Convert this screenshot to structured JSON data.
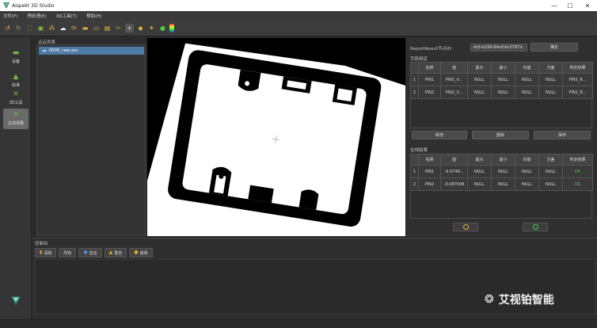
{
  "window": {
    "title": "Aispekt 3D Studio",
    "controls": [
      "—",
      "☐",
      "✕"
    ]
  },
  "menu": [
    "文件(F)",
    "预处理(E)",
    "3D工具(T)",
    "帮助(H)"
  ],
  "toolbar_icons": [
    "undo-icon",
    "redo-icon",
    "fit-view-icon",
    "select-box-icon",
    "points-icon",
    "cloud-icon",
    "rotate-icon",
    "folder-icon",
    "folder-open-icon",
    "save-icon",
    "crop-icon",
    "crosshair-icon",
    "cube-icon",
    "wand-icon",
    "sphere-icon",
    "color-map-icon"
  ],
  "sidebar": {
    "items": [
      {
        "label": "设备",
        "icon": "device-icon"
      },
      {
        "label": "标准",
        "icon": "standard-icon"
      },
      {
        "label": "3D工具",
        "icon": "3d-tool-icon"
      },
      {
        "label": "在线测量",
        "icon": "online-measure-icon",
        "active": true
      }
    ]
  },
  "cloud_list": {
    "label": "点云列表",
    "items": [
      "0006_raw.asc"
    ]
  },
  "report": {
    "node_label": "ReportResult节点ID",
    "node_id": "dc6-b296-8fed1bc0787d",
    "confirm": "确定"
  },
  "field_binding": {
    "label": "字段绑定",
    "columns": [
      "",
      "名称",
      "值",
      "最大",
      "最小",
      "均值",
      "方差",
      "判定结果"
    ],
    "rows": [
      [
        "1",
        "PIN1",
        "PIN1_V...",
        "NULL",
        "NULL",
        "NULL",
        "NULL",
        "PIN1_R..."
      ],
      [
        "2",
        "PIN2",
        "PIN2_V...",
        "NULL",
        "NULL",
        "NULL",
        "NULL",
        "PIN2_R..."
      ]
    ],
    "buttons": {
      "add": "新增",
      "delete": "删除",
      "save": "保存"
    }
  },
  "online_results": {
    "label": "在线结果",
    "columns": [
      "",
      "名称",
      "值",
      "最大",
      "最小",
      "均值",
      "方差",
      "判定结果"
    ],
    "rows": [
      [
        "1",
        "PIN1",
        "-0.0749...",
        "NULL",
        "NULL",
        "NULL",
        "NULL",
        "OK"
      ],
      [
        "2",
        "PIN2",
        "-0.087699",
        "NULL",
        "NULL",
        "NULL",
        "NULL",
        "OK"
      ]
    ]
  },
  "console": {
    "label": "控制台",
    "buttons": [
      {
        "label": "清除",
        "icon": "clear-icon",
        "color": "#e0a030"
      },
      {
        "label": "所有",
        "icon": "",
        "color": ""
      },
      {
        "label": "信息",
        "icon": "info-icon",
        "color": "#4a90d9"
      },
      {
        "label": "警告",
        "icon": "warning-icon",
        "color": "#e8b020"
      },
      {
        "label": "错误",
        "icon": "error-icon",
        "color": "#e8b020"
      }
    ]
  },
  "watermark": "艾视铂智能",
  "colors": {
    "accent_green": "#7ab648",
    "selection_blue": "#4e7aa6",
    "ok_green": "#4ec94e"
  }
}
